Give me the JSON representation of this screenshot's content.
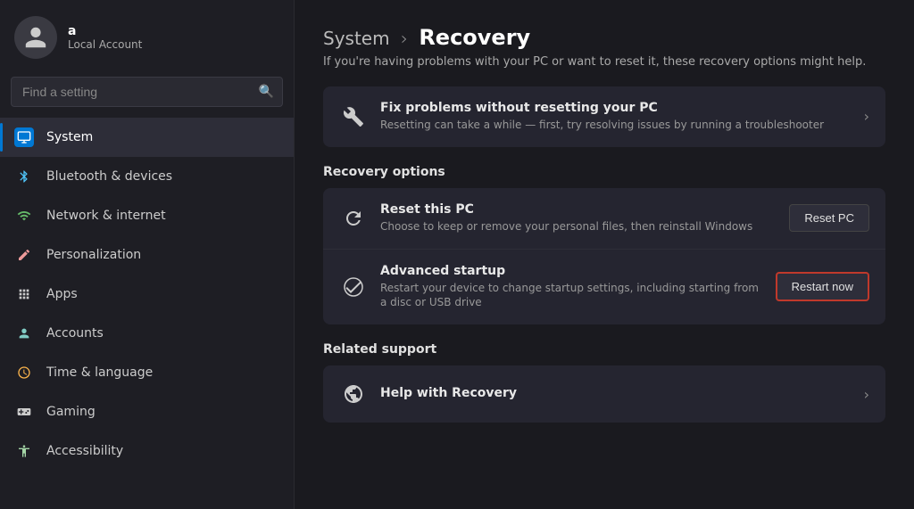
{
  "sidebar": {
    "user": {
      "name": "a",
      "account_type": "Local Account"
    },
    "search": {
      "placeholder": "Find a setting"
    },
    "nav_items": [
      {
        "id": "system",
        "label": "System",
        "icon_type": "system",
        "active": true
      },
      {
        "id": "bluetooth",
        "label": "Bluetooth & devices",
        "icon_type": "bluetooth",
        "active": false
      },
      {
        "id": "network",
        "label": "Network & internet",
        "icon_type": "network",
        "active": false
      },
      {
        "id": "personalization",
        "label": "Personalization",
        "icon_type": "personalization",
        "active": false
      },
      {
        "id": "apps",
        "label": "Apps",
        "icon_type": "apps",
        "active": false
      },
      {
        "id": "accounts",
        "label": "Accounts",
        "icon_type": "accounts",
        "active": false
      },
      {
        "id": "time",
        "label": "Time & language",
        "icon_type": "time",
        "active": false
      },
      {
        "id": "gaming",
        "label": "Gaming",
        "icon_type": "gaming",
        "active": false
      },
      {
        "id": "accessibility",
        "label": "Accessibility",
        "icon_type": "accessibility",
        "active": false
      }
    ]
  },
  "main": {
    "breadcrumb_parent": "System",
    "breadcrumb_sep": "›",
    "breadcrumb_current": "Recovery",
    "page_description": "If you're having problems with your PC or want to reset it, these recovery options might help.",
    "fix_problems": {
      "title": "Fix problems without resetting your PC",
      "subtitle": "Resetting can take a while — first, try resolving issues by running a troubleshooter"
    },
    "recovery_options_label": "Recovery options",
    "recovery_items": [
      {
        "id": "reset-pc",
        "title": "Reset this PC",
        "subtitle": "Choose to keep or remove your personal files, then reinstall Windows",
        "button_label": "Reset PC",
        "highlighted": false
      },
      {
        "id": "advanced-startup",
        "title": "Advanced startup",
        "subtitle": "Restart your device to change startup settings, including starting from a disc or USB drive",
        "button_label": "Restart now",
        "highlighted": true
      }
    ],
    "related_support_label": "Related support",
    "help_item": {
      "title": "Help with Recovery"
    }
  }
}
